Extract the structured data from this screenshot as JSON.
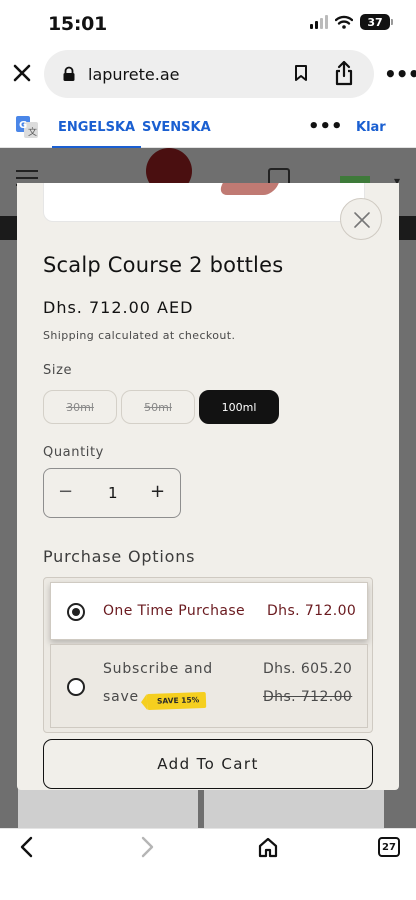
{
  "status_bar": {
    "time": "15:01",
    "battery": "37"
  },
  "browser": {
    "url": "lapurete.ae",
    "translate": {
      "from_lang": "ENGELSKA",
      "to_lang": "SVENSKA",
      "done_label": "Klar"
    },
    "tab_count": "27"
  },
  "product": {
    "title": "Scalp Course 2 bottles",
    "price": "Dhs. 712.00 AED",
    "shipping_note": "Shipping calculated at checkout.",
    "size_label": "Size",
    "sizes": [
      {
        "label": "30ml",
        "state": "unavailable"
      },
      {
        "label": "50ml",
        "state": "unavailable"
      },
      {
        "label": "100ml",
        "state": "selected"
      }
    ],
    "quantity_label": "Quantity",
    "quantity": "1",
    "purchase_options_label": "Purchase Options",
    "options": {
      "one_time": {
        "label": "One Time Purchase",
        "price": "Dhs. 712.00",
        "selected": true
      },
      "subscribe": {
        "label_line1": "Subscribe and",
        "label_line2": "save",
        "badge": "SAVE 15%",
        "price": "Dhs. 605.20",
        "old_price": "Dhs. 712.00",
        "selected": false
      }
    },
    "add_to_cart_label": "Add To Cart"
  },
  "colors": {
    "accent_text": "#6a1a1f",
    "button_dark": "#121212",
    "badge_yellow": "#f5cf1f",
    "link_blue": "#1a5fd1",
    "sheet_bg": "#f1efea"
  },
  "icons": [
    "close-icon",
    "lock-icon",
    "bookmark-icon",
    "share-icon",
    "more-icon",
    "google-translate-icon",
    "hamburger-icon",
    "cart-icon",
    "flag-icon",
    "back-icon",
    "forward-icon",
    "home-icon",
    "tabs-icon"
  ]
}
